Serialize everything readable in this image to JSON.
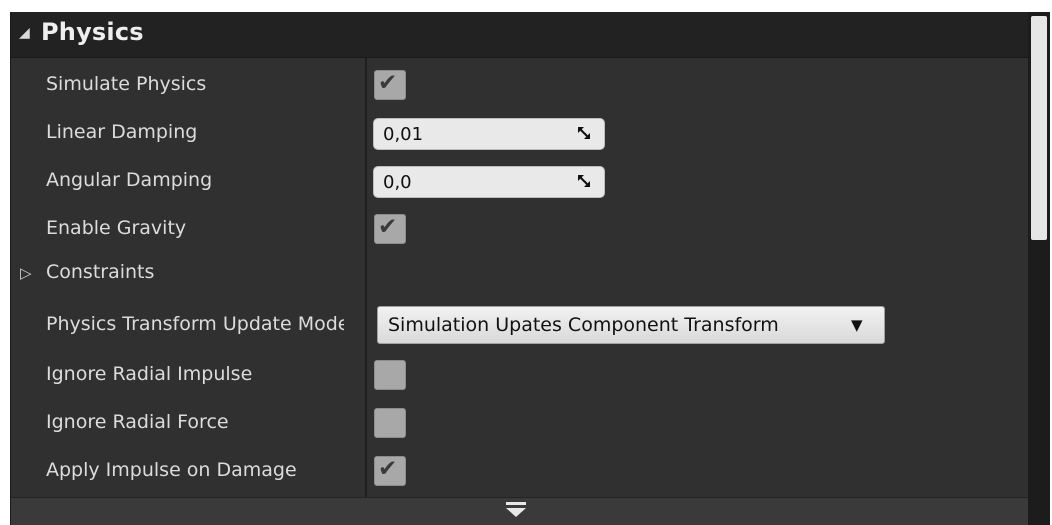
{
  "section": {
    "title": "Physics",
    "expanded_icon": "triangle-down-right-icon"
  },
  "rows": {
    "simulate_physics": {
      "label": "Simulate Physics",
      "checked": true
    },
    "linear_damping": {
      "label": "Linear Damping",
      "value": "0,01"
    },
    "angular_damping": {
      "label": "Angular Damping",
      "value": "0,0"
    },
    "enable_gravity": {
      "label": "Enable Gravity",
      "checked": true
    },
    "constraints": {
      "label": "Constraints",
      "expander": "▷"
    },
    "physics_transform": {
      "label": "Physics Transform Update Mode",
      "value": "Simulation Upates Component Transform"
    },
    "ignore_radial_impulse": {
      "label": "Ignore Radial Impulse",
      "checked": false
    },
    "ignore_radial_force": {
      "label": "Ignore Radial Force",
      "checked": false
    },
    "apply_impulse_on_damage": {
      "label": "Apply Impulse on Damage",
      "checked": true
    }
  },
  "checkmark": "✔",
  "footer": {
    "icon": "expand-advanced-icon"
  }
}
